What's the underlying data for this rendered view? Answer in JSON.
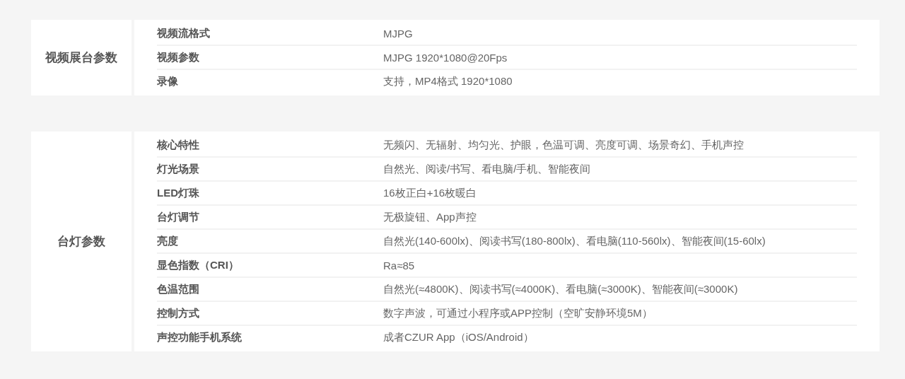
{
  "sections": [
    {
      "title": "视频展台参数",
      "rows": [
        {
          "label": "视频流格式",
          "value": "MJPG"
        },
        {
          "label": "视频参数",
          "value": "MJPG 1920*1080@20Fps"
        },
        {
          "label": "录像",
          "value": "支持，MP4格式 1920*1080"
        }
      ]
    },
    {
      "title": "台灯参数",
      "rows": [
        {
          "label": "核心特性",
          "value": "无频闪、无辐射、均匀光、护眼，色温可调、亮度可调、场景奇幻、手机声控"
        },
        {
          "label": "灯光场景",
          "value": "自然光、阅读/书写、看电脑/手机、智能夜间"
        },
        {
          "label": "LED灯珠",
          "value": "16枚正白+16枚暖白"
        },
        {
          "label": "台灯调节",
          "value": "无极旋钮、App声控"
        },
        {
          "label": "亮度",
          "value": "自然光(140-600lx)、阅读书写(180-800lx)、看电脑(110-560lx)、智能夜间(15-60lx)"
        },
        {
          "label": "显色指数（CRI）",
          "value": "Ra≈85"
        },
        {
          "label": "色温范围",
          "value": "自然光(≈4800K)、阅读书写(≈4000K)、看电脑(≈3000K)、智能夜间(≈3000K)"
        },
        {
          "label": "控制方式",
          "value": "数字声波，可通过小程序或APP控制（空旷安静环境5M）"
        },
        {
          "label": "声控功能手机系统",
          "value": "成者CZUR App（iOS/Android）"
        }
      ]
    }
  ]
}
